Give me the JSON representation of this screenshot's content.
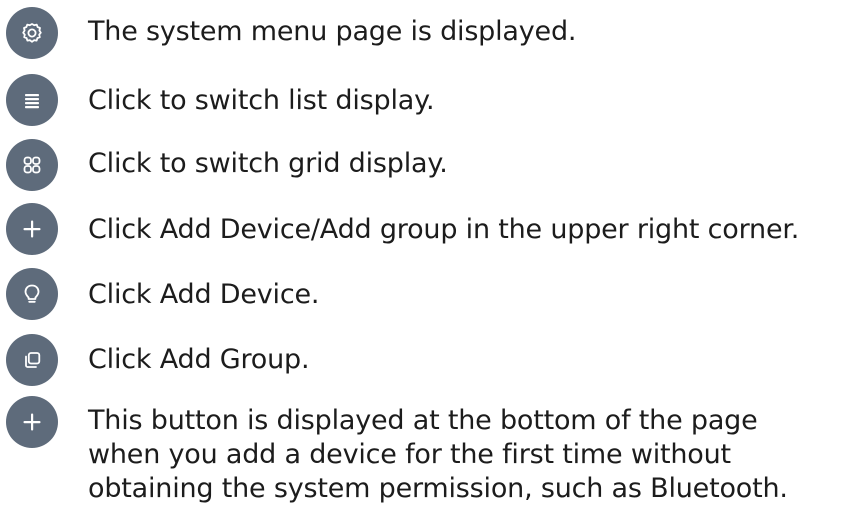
{
  "items": [
    {
      "icon": "gear-icon",
      "text": "The system menu page is displayed."
    },
    {
      "icon": "list-icon",
      "text": "Click to switch list display."
    },
    {
      "icon": "grid-icon",
      "text": "Click to switch grid display."
    },
    {
      "icon": "plus-icon",
      "text": "Click Add Device/Add group in the upper right corner."
    },
    {
      "icon": "lightbulb-icon",
      "text": "Click Add Device."
    },
    {
      "icon": "group-icon",
      "text": "Click Add Group."
    },
    {
      "icon": "plus-icon",
      "lines": [
        "This button is displayed at the bottom of the page",
        "when you add a device for the first time without",
        "obtaining the system permission, such as Bluetooth."
      ]
    }
  ],
  "colors": {
    "icon_bg": "#5e6b7b",
    "icon_fg": "#ffffff",
    "text": "#1c1c1c"
  }
}
